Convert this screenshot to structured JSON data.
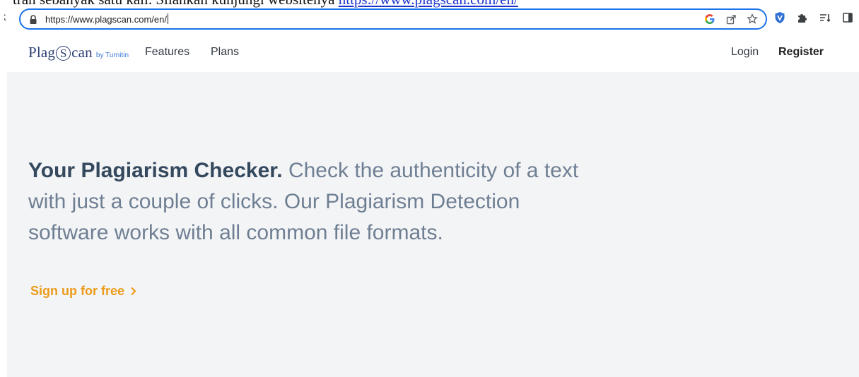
{
  "document": {
    "text_prefix": "tran sebanyak satu kali. Silahkan kunjungi websitenya ",
    "link": "https://www.plagscan.com/en/"
  },
  "browser": {
    "url": "https://www.plagscan.com/en/",
    "accent": "#1a73e8",
    "omnibox_icons": [
      "google-lens-icon",
      "share-icon",
      "bookmark-star-icon"
    ],
    "extension_icons": [
      "shield-extension-icon",
      "puzzle-extensions-icon",
      "reading-list-icon",
      "side-panel-icon"
    ]
  },
  "site": {
    "logo": {
      "main_left": "Plag",
      "main_s": "S",
      "main_right": "can",
      "by": "by Turnitin"
    },
    "nav": {
      "features": "Features",
      "plans": "Plans",
      "login": "Login",
      "register": "Register"
    },
    "hero": {
      "headline_strong": "Your Plagiarism Checker.",
      "headline_rest": " Check the authenticity of a text with just a couple of clicks. Our Plagiarism Detection software works with all common file formats.",
      "cta": "Sign up for free"
    },
    "colors": {
      "brand": "#2b3f73",
      "cta": "#ec9b1a",
      "hero_bg": "#f3f4f6"
    }
  }
}
